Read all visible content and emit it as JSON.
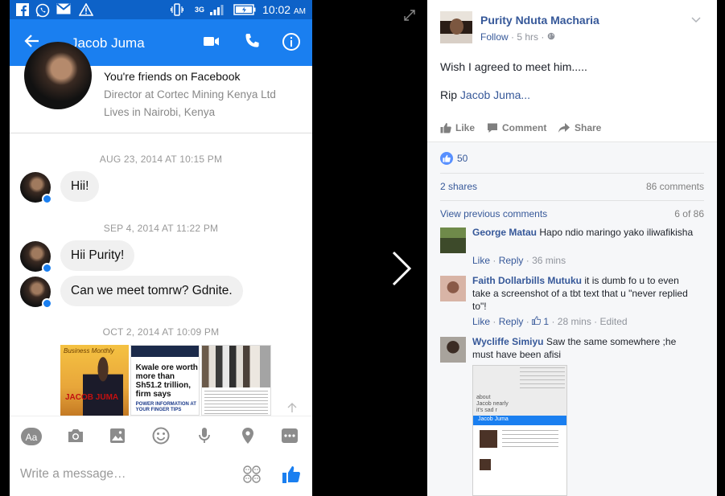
{
  "messenger": {
    "status_time": "10:02",
    "status_ampm": "AM",
    "contact_name": "Jacob Juma",
    "profile": {
      "line1": "You're friends on Facebook",
      "line2": "Director at Cortec Mining Kenya Ltd",
      "line3": "Lives in Nairobi, Kenya"
    },
    "stamps": [
      "AUG 23, 2014 AT 10:15 PM",
      "SEP 4, 2014 AT 11:22 PM",
      "OCT 2, 2014 AT 10:09 PM"
    ],
    "messages": [
      "Hii!",
      "Hii Purity!",
      "Can we meet tomrw? Gdnite."
    ],
    "shared": {
      "card1_header": "Business Monthly",
      "card1_name": "JACOB JUMA",
      "card2_headline": "Kwale ore worth more than Sh51.2 trillion, firm says",
      "card2_footer": "POWER INFORMATION AT YOUR FINGER TIPS"
    },
    "composer_placeholder": "Write a message…"
  },
  "post": {
    "author": "Purity Nduta Macharia",
    "follow": "Follow",
    "age": "5 hrs",
    "line1": "Wish I agreed to meet him.....",
    "line2_prefix": "Rip ",
    "line2_link": "Jacob Juma...",
    "actions": {
      "like": "Like",
      "comment": "Comment",
      "share": "Share"
    },
    "reactions_count": "50",
    "shares": "2 shares",
    "comments_count": "86 comments",
    "view_previous": "View previous comments",
    "page_count": "6 of 86",
    "comments": [
      {
        "name": "George Matau",
        "text": "Hapo ndio maringo yako iliwafikisha",
        "like": "Like",
        "reply": "Reply",
        "time": "36 mins",
        "reactions": "",
        "edited": ""
      },
      {
        "name": "Faith Dollarbills Mutuku",
        "text": "it is dumb fo u to even take a screenshot of a tbt text that u \"never replied to\"!",
        "like": "Like",
        "reply": "Reply",
        "time": "28 mins",
        "reactions": "1",
        "edited": "Edited"
      },
      {
        "name": "Wycliffe Simiyu",
        "text": "Saw the same somewhere ;he must have been afisi"
      }
    ],
    "screenshot": {
      "bar_name": "Jacob Juma",
      "side_text": "about\nJacob nearly\nit's sad r"
    }
  },
  "colors": {
    "messenger_blue": "#1a7ff0",
    "status_bar": "#0d62c8",
    "facebook_link": "#365899"
  }
}
